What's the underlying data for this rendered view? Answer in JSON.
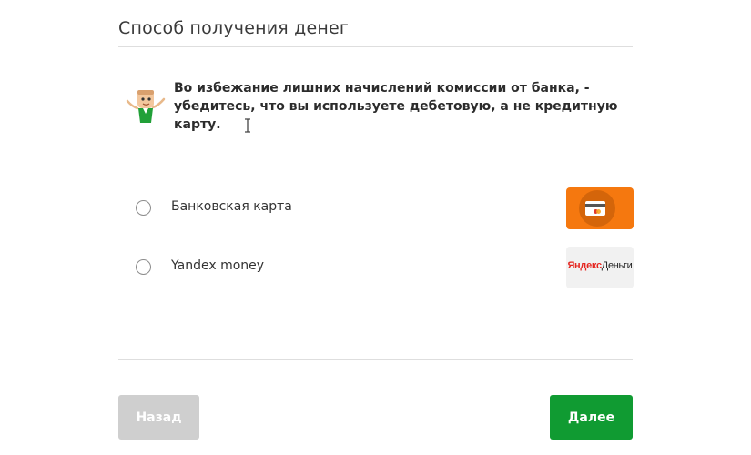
{
  "page": {
    "title": "Способ получения денег"
  },
  "notice": {
    "text": "Во избежание лишних начислений комиссии от банка, - убедитесь, что вы используете дебетовую, а не кредитную карту.",
    "mascot_icon": "mascot-icon"
  },
  "options": [
    {
      "label": "Банковская карта",
      "selected": false,
      "logo_icon": "bank-card-icon",
      "logo_color": "#f5780f"
    },
    {
      "label": "Yandex money",
      "selected": false,
      "logo_icon": "yandex-money-logo",
      "logo_text_ya": "Яндекс",
      "logo_text_rest": "Деньги"
    }
  ],
  "buttons": {
    "back_label": "Назад",
    "next_label": "Далее",
    "back_color": "#cfcfcf",
    "next_color": "#109b32"
  }
}
